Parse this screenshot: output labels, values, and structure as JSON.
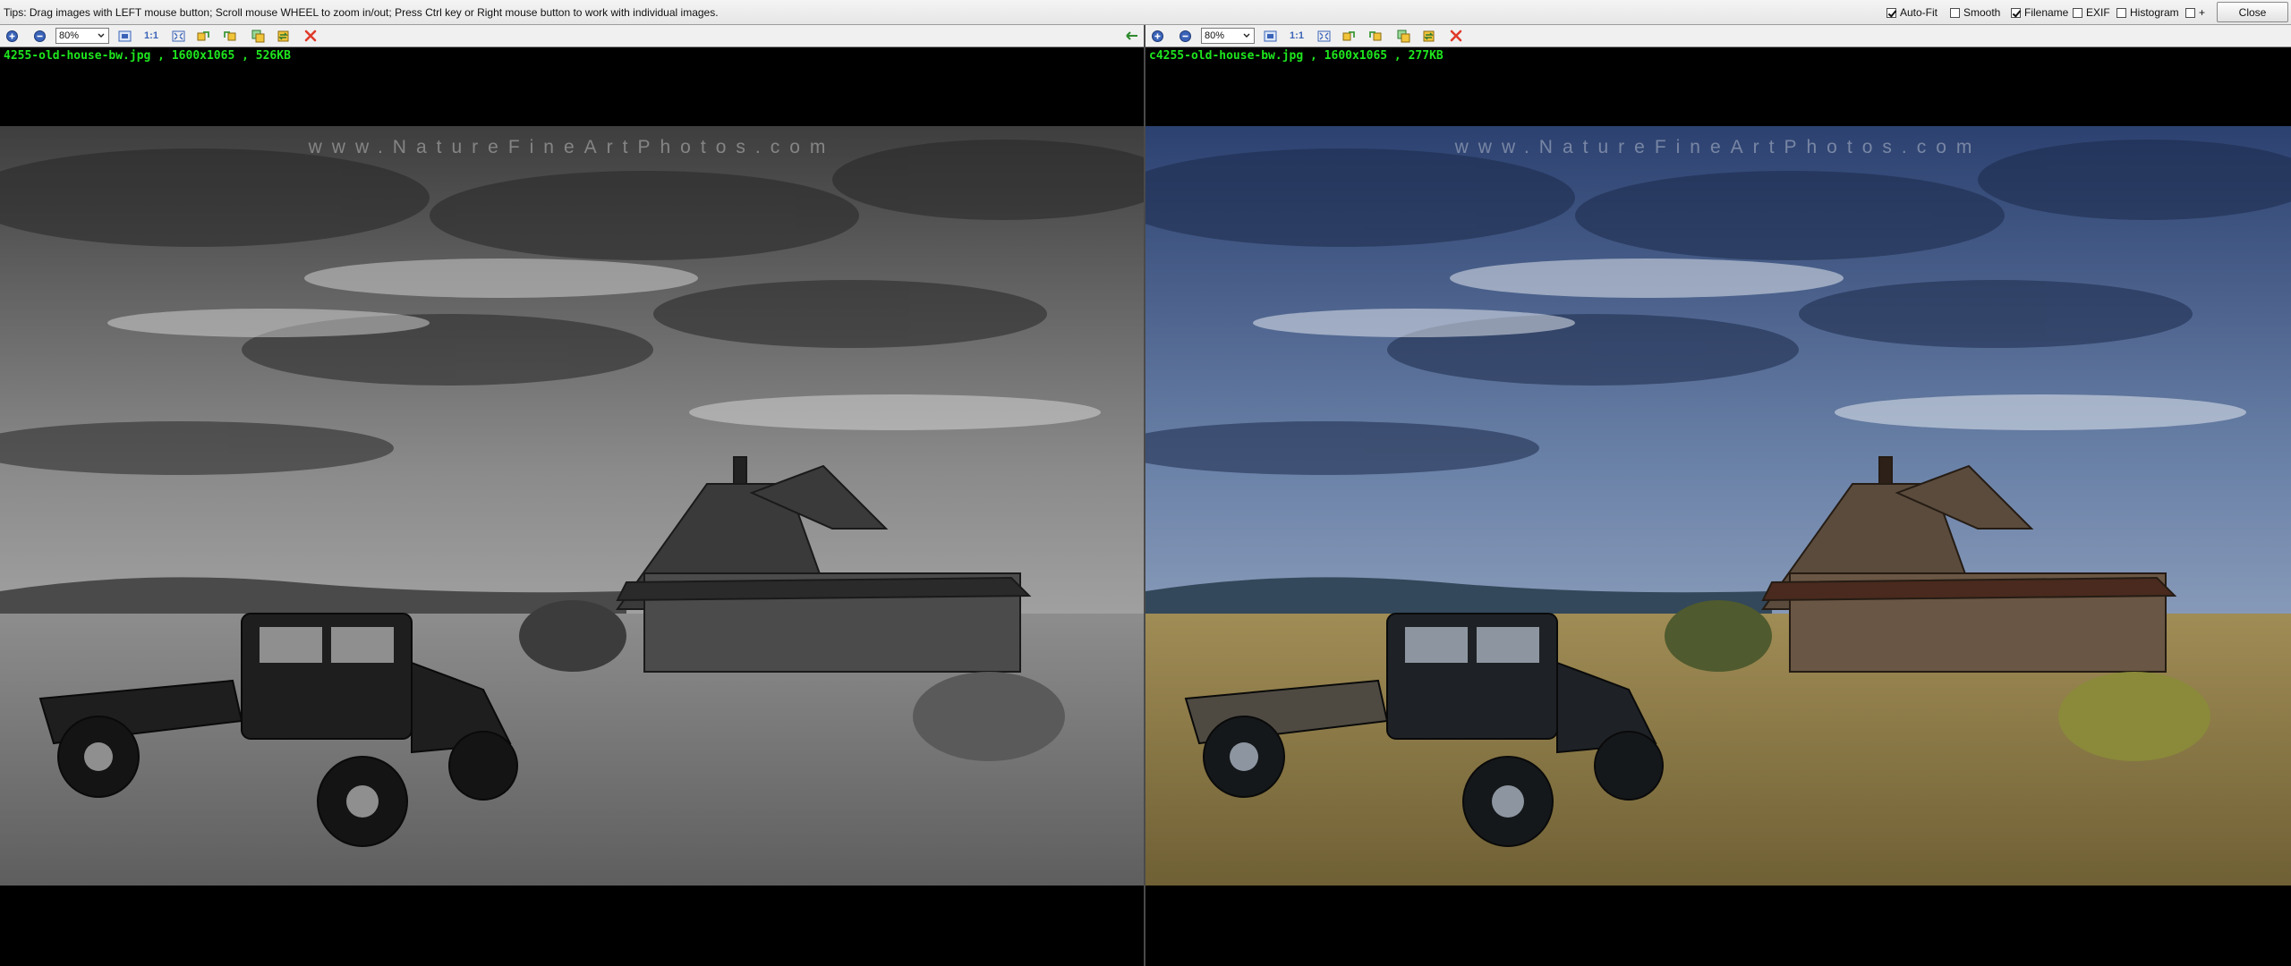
{
  "window": {
    "tips": "Tips: Drag images with LEFT mouse button; Scroll mouse WHEEL to zoom in/out; Press Ctrl key or Right mouse button to work with individual images.",
    "options": [
      {
        "label": "Auto-Fit",
        "checked": true
      },
      {
        "label": "Smooth",
        "checked": false
      },
      {
        "label": "Filename",
        "checked": true
      },
      {
        "label": "EXIF",
        "checked": false
      },
      {
        "label": "Histogram",
        "checked": false
      },
      {
        "label": "+",
        "checked": false
      }
    ],
    "close_label": "Close"
  },
  "left_pane": {
    "zoom": "80%",
    "one_to_one": "1:1",
    "file_info": "4255-old-house-bw.jpg , 1600x1065 , 526KB",
    "watermark": "www.NatureFineArtPhotos.com",
    "tone": "monochrome"
  },
  "right_pane": {
    "zoom": "80%",
    "one_to_one": "1:1",
    "file_info": "c4255-old-house-bw.jpg , 1600x1065 , 277KB",
    "watermark": "www.NatureFineArtPhotos.com",
    "tone": "color"
  },
  "colors": {
    "file_info_text": "#1ee61e",
    "delete_icon": "#e03a2a",
    "zoom_icon": "#3a63b8",
    "sync_icon": "#3e9a3a"
  }
}
